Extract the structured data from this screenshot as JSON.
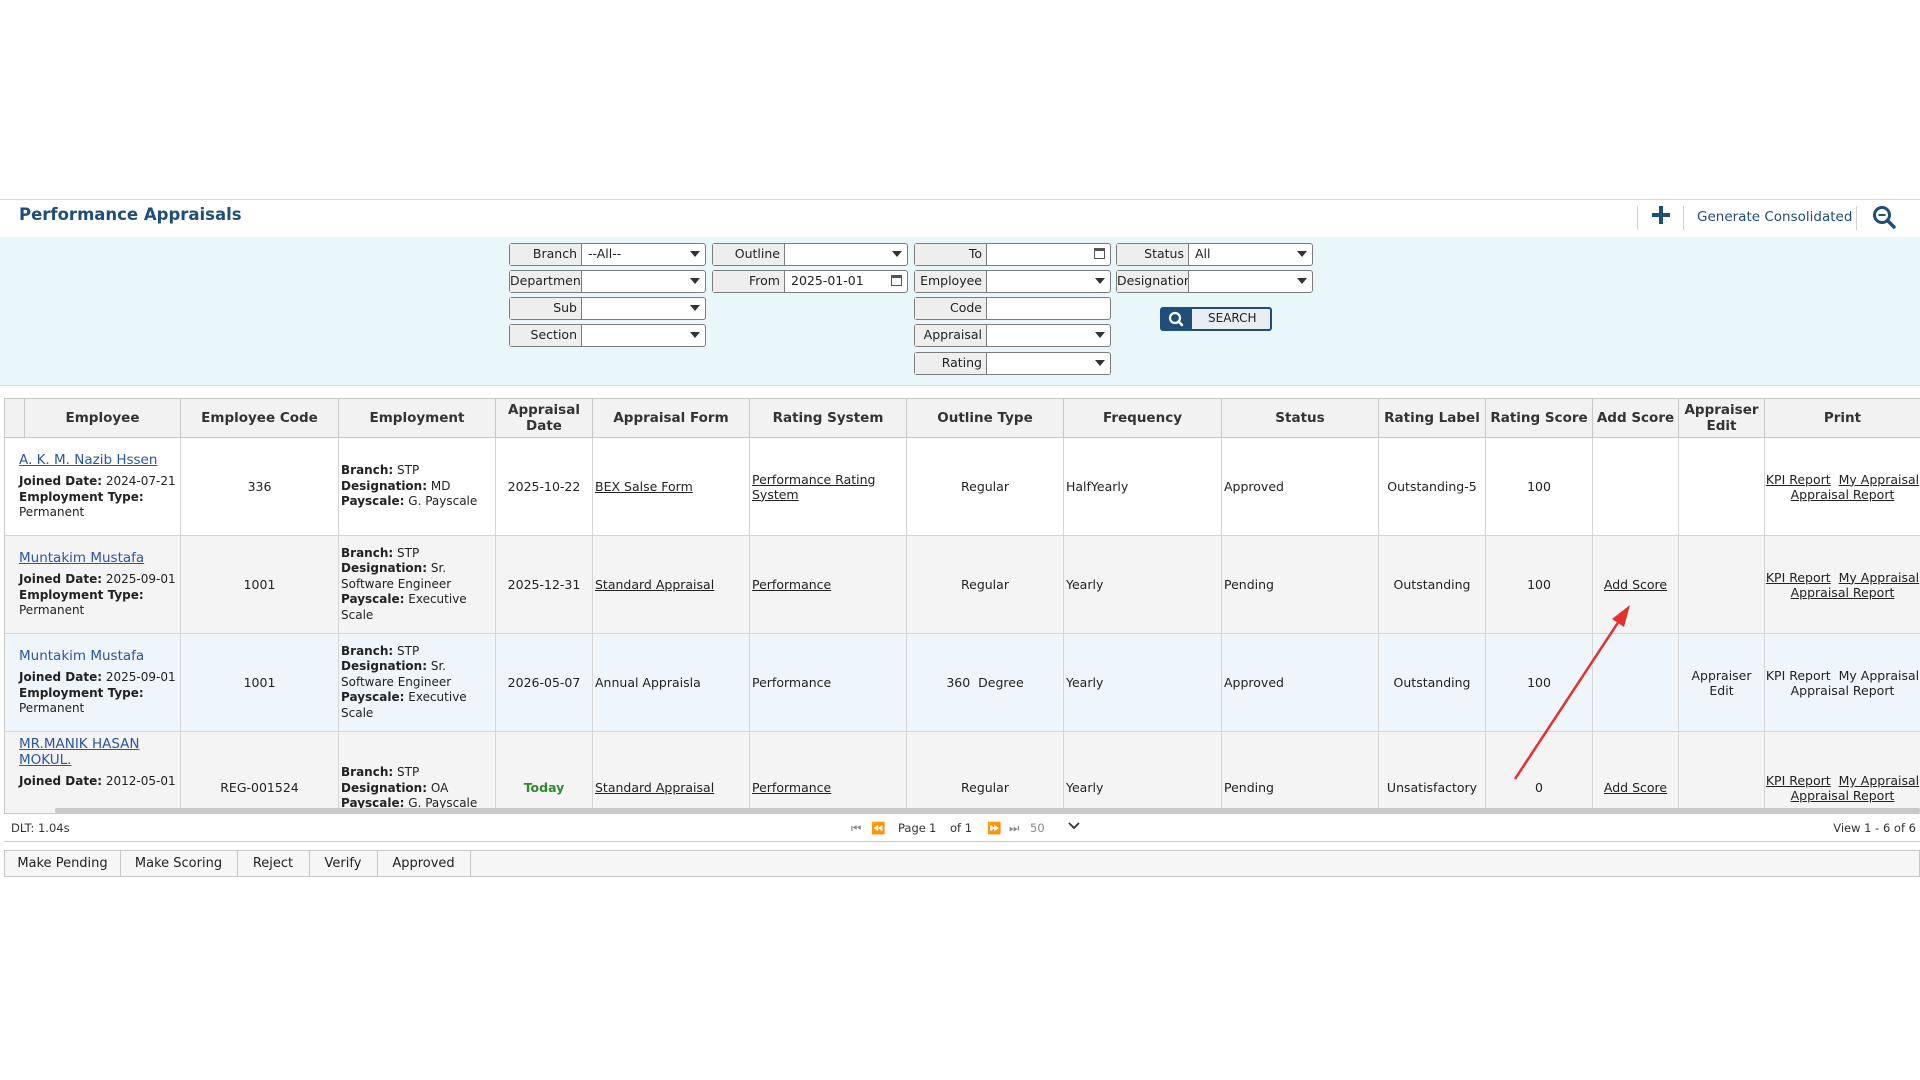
{
  "header": {
    "title": "Performance Appraisals",
    "generate_consolidated": "Generate Consolidated"
  },
  "filters": {
    "branch": {
      "label": "Branch",
      "value": "--All--"
    },
    "department": {
      "label": "Departmen",
      "value": ""
    },
    "sub": {
      "label": "Sub",
      "value": ""
    },
    "section": {
      "label": "Section",
      "value": ""
    },
    "outline": {
      "label": "Outline",
      "value": ""
    },
    "from": {
      "label": "From",
      "value": "2025-01-01"
    },
    "to": {
      "label": "To",
      "value": ""
    },
    "employee": {
      "label": "Employee",
      "value": ""
    },
    "code": {
      "label": "Code",
      "value": ""
    },
    "appraisal": {
      "label": "Appraisal",
      "value": ""
    },
    "rating": {
      "label": "Rating",
      "value": ""
    },
    "status": {
      "label": "Status",
      "value": "All"
    },
    "designation": {
      "label": "Designation",
      "value": ""
    },
    "search_label": "SEARCH"
  },
  "table": {
    "headers": {
      "employee": "Employee",
      "employee_code": "Employee Code",
      "employment": "Employment",
      "appraisal_date": "Appraisal Date",
      "appraisal_form": "Appraisal Form",
      "rating_system": "Rating System",
      "outline_type": "Outline Type",
      "frequency": "Frequency",
      "status": "Status",
      "rating_label": "Rating Label",
      "rating_score": "Rating Score",
      "add_score": "Add Score",
      "appraiser_edit": "Appraiser Edit",
      "print": "Print"
    },
    "field_labels": {
      "joined": "Joined Date:",
      "emp_type": "Employment Type:",
      "branch": "Branch:",
      "designation": "Designation:",
      "payscale": "Payscale:"
    },
    "rows": [
      {
        "name": "A. K. M. Nazib Hssen",
        "joined": "2024-07-21",
        "emp_type": "Permanent",
        "code": "336",
        "branch": "STP",
        "designation": "MD",
        "payscale": "G. Payscale",
        "date": "2025-10-22",
        "form": "BEX Salse Form",
        "rating_system": "Performance Rating System",
        "outline": "Regular",
        "frequency": "HalfYearly",
        "status": "Approved",
        "rating_label": "Outstanding-5",
        "score": "100",
        "add_score": "",
        "appraiser_edit": "",
        "kpi": "KPI Report",
        "my_appraisal": "My Appraisal",
        "appraisal_report": "Appraisal Report"
      },
      {
        "name": "Muntakim Mustafa",
        "joined": "2025-09-01",
        "emp_type": "Permanent",
        "code": "1001",
        "branch": "STP",
        "designation": "Sr. Software Engineer",
        "payscale": "Executive Scale",
        "date": "2025-12-31",
        "form": "Standard Appraisal",
        "rating_system": "Performance",
        "outline": "Regular",
        "frequency": "Yearly",
        "status": "Pending",
        "rating_label": "Outstanding",
        "score": "100",
        "add_score": "Add Score",
        "appraiser_edit": "",
        "kpi": "KPI Report",
        "my_appraisal": "My Appraisal",
        "appraisal_report": "Appraisal Report"
      },
      {
        "name": "Muntakim Mustafa",
        "joined": "2025-09-01",
        "emp_type": "Permanent",
        "code": "1001",
        "branch": "STP",
        "designation": "Sr. Software Engineer",
        "payscale": "Executive Scale",
        "date": "2026-05-07",
        "form": "Annual Appraisla",
        "rating_system": "Performance",
        "outline": "360  Degree",
        "frequency": "Yearly",
        "status": "Approved",
        "rating_label": "Outstanding",
        "score": "100",
        "add_score": "",
        "appraiser_edit": "Appraiser Edit",
        "kpi": "KPI Report",
        "my_appraisal": "My Appraisal",
        "appraisal_report": "Appraisal Report"
      },
      {
        "name": "MR.MANIK HASAN MOKUL.",
        "joined": "2012-05-01",
        "emp_type": "",
        "code": "REG-001524",
        "branch": "STP",
        "designation": "OA",
        "payscale": "G. Payscale",
        "date": "Today",
        "form": "Standard Appraisal",
        "rating_system": "Performance",
        "outline": "Regular",
        "frequency": "Yearly",
        "status": "Pending",
        "rating_label": "Unsatisfactory",
        "score": "0",
        "add_score": "Add Score",
        "appraiser_edit": "",
        "kpi": "KPI Report",
        "my_appraisal": "My Appraisal",
        "appraisal_report": "Appraisal Report"
      }
    ]
  },
  "pager": {
    "dlt": "DLT: 1.04s",
    "page_label": "Page",
    "page": "1",
    "of": "of 1",
    "per_page": "50",
    "view": "View 1 - 6 of 6"
  },
  "actions": [
    "Make Pending",
    "Make Scoring",
    "Reject",
    "Verify",
    "Approved"
  ],
  "colors": {
    "brand": "#1f4e79",
    "filter_bg": "#e9f7fa",
    "link": "#2a56a8",
    "arrow": "#e53030"
  }
}
